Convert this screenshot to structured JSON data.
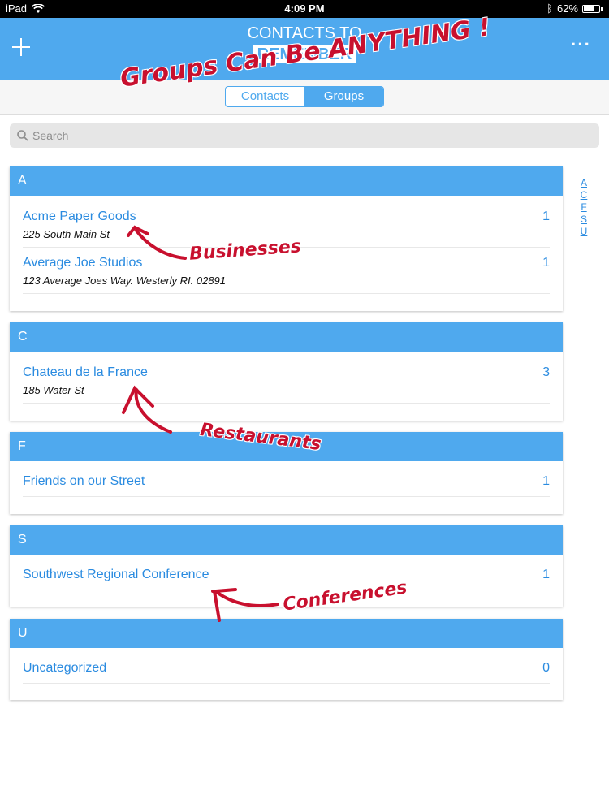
{
  "status_bar": {
    "device": "iPad",
    "time": "4:09 PM",
    "battery": "62%"
  },
  "header": {
    "title_line1": "CONTACTS TO",
    "title_line2": "REMEMBER",
    "add_icon": "plus-icon",
    "more_icon": "ellipsis-icon"
  },
  "segments": {
    "contacts": "Contacts",
    "groups": "Groups",
    "selected": "Groups"
  },
  "search": {
    "placeholder": "Search"
  },
  "sections": [
    {
      "letter": "A",
      "rows": [
        {
          "name": "Acme Paper Goods",
          "address": "225 South Main St",
          "count": "1"
        },
        {
          "name": "Average Joe Studios",
          "address": "123 Average Joes Way. Westerly RI. 02891",
          "count": "1"
        }
      ]
    },
    {
      "letter": "C",
      "rows": [
        {
          "name": "Chateau de la France",
          "address": "185 Water St",
          "count": "3"
        }
      ]
    },
    {
      "letter": "F",
      "rows": [
        {
          "name": "Friends on our Street",
          "count": "1"
        }
      ]
    },
    {
      "letter": "S",
      "rows": [
        {
          "name": "Southwest Regional Conference",
          "count": "1"
        }
      ]
    },
    {
      "letter": "U",
      "rows": [
        {
          "name": "Uncategorized",
          "count": "0"
        }
      ]
    }
  ],
  "index": [
    "A",
    "C",
    "F",
    "S",
    "U"
  ],
  "annotations": {
    "headline": "Groups Can Be ANYTHING !",
    "businesses": "Businesses",
    "restaurants": "Restaurants",
    "conferences": "Conferences",
    "color": "#c8102e"
  },
  "colors": {
    "accent": "#4fa9ee",
    "link": "#2a8be0"
  }
}
